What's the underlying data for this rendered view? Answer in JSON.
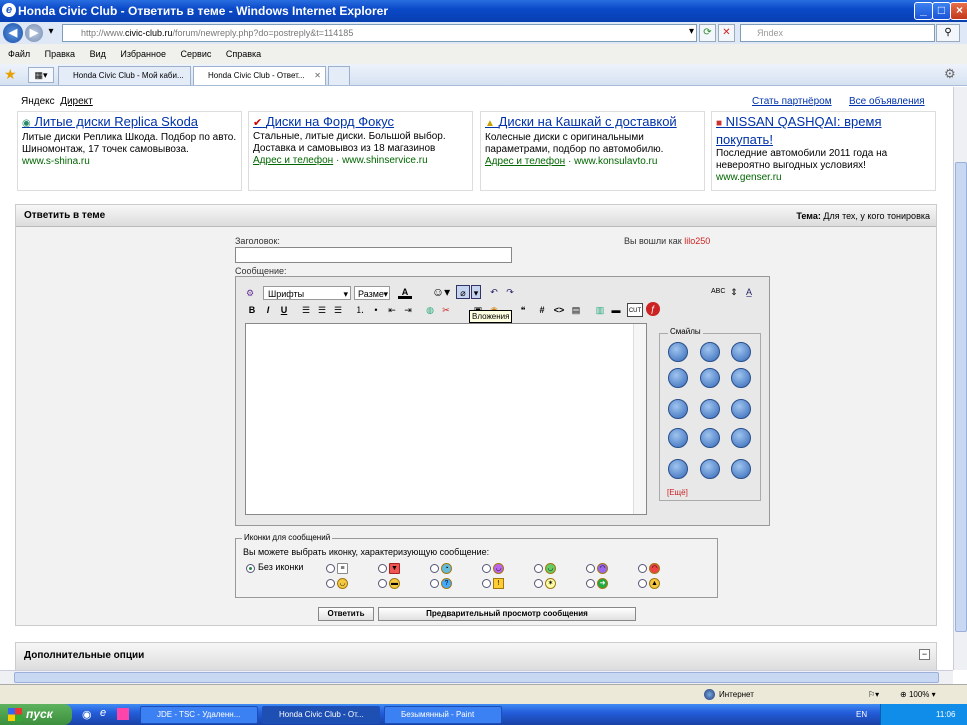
{
  "window": {
    "title": "Honda Civic Club - Ответить в теме - Windows Internet Explorer"
  },
  "address": {
    "prefix": "http://www.",
    "domain": "civic-club.ru",
    "path": "/forum/newreply.php?do=postreply&t=114185"
  },
  "search": {
    "placeholder": "Яndex"
  },
  "menu": [
    "Файл",
    "Правка",
    "Вид",
    "Избранное",
    "Сервис",
    "Справка"
  ],
  "tabs": [
    {
      "label": "Honda Civic Club - Мой каби..."
    },
    {
      "label": "Honda Civic Club - Ответ..."
    }
  ],
  "yandex": {
    "brand": "Яндекс",
    "direct": "Директ",
    "partner": "Стать партнёром",
    "all_ads": "Все объявления"
  },
  "ads": [
    {
      "title": "Литые диски Replica Skoda",
      "text": "Литые диски Реплика Шкода. Подбор по авто. Шиномонтаж, 17 точек самовывоза.",
      "contact": "",
      "url": "www.s-shina.ru"
    },
    {
      "title": "Диски на Форд Фокус",
      "text": "Стальные, литые диски. Большой выбор. Доставка и самовывоз из 18 магазинов",
      "contact": "Адрес и телефон",
      "url": "www.shinservice.ru"
    },
    {
      "title": "Диски на Кашкай с доставкой",
      "text": "Колесные диски с оригинальными параметрами, подбор по автомобилю.",
      "contact": "Адрес и телефон",
      "url": "www.konsulavto.ru"
    },
    {
      "title": "NISSAN QASHQAI: время покупать!",
      "text": "Последние автомобили 2011 года на невероятно выгодных условиях!",
      "contact": "",
      "url": "www.genser.ru"
    }
  ],
  "reply": {
    "heading": "Ответить в теме",
    "topic_label": "Тема:",
    "topic": "Для тех, у кого тонировка",
    "subject_label": "Заголовок:",
    "logged_in": "Вы вошли как",
    "user": "lilo250",
    "message_label": "Сообщение:",
    "font_select": "Шрифты",
    "size_select": "Разме",
    "tooltip": "Вложения",
    "smilies_title": "Смайлы",
    "more_smilies": "[Ещё]"
  },
  "icons": {
    "legend": "Иконки для сообщений",
    "hint": "Вы можете выбрать иконку, характеризующую сообщение:",
    "none": "Без иконки"
  },
  "buttons": {
    "submit": "Ответить",
    "preview": "Предварительный просмотр сообщения"
  },
  "extra": {
    "heading": "Дополнительные опции"
  },
  "status": {
    "zone": "Интернет",
    "zoom": "100%"
  },
  "taskbar": {
    "start": "пуск",
    "tasks": [
      "JDE - TSC - Удаленн...",
      "Honda Civic Club - От...",
      "Безымянный - Paint"
    ],
    "lang": "EN",
    "time": "11:06"
  }
}
